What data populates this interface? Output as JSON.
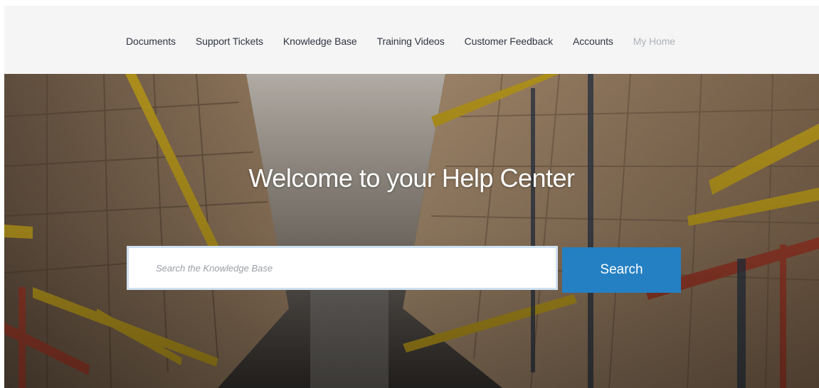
{
  "nav": {
    "items": [
      {
        "label": "Documents"
      },
      {
        "label": "Support Tickets"
      },
      {
        "label": "Knowledge Base"
      },
      {
        "label": "Training Videos"
      },
      {
        "label": "Customer Feedback"
      },
      {
        "label": "Accounts"
      },
      {
        "label": "My Home"
      }
    ]
  },
  "hero": {
    "title": "Welcome to your Help Center",
    "background": "warehouse-aisle-photo"
  },
  "search": {
    "placeholder": "Search the Knowledge Base",
    "value": "",
    "button_label": "Search"
  },
  "colors": {
    "nav_background": "#f5f5f5",
    "nav_text": "#2f3542",
    "nav_muted": "#aeb2b8",
    "accent": "#2580c3",
    "input_border": "#cfe1f1"
  }
}
